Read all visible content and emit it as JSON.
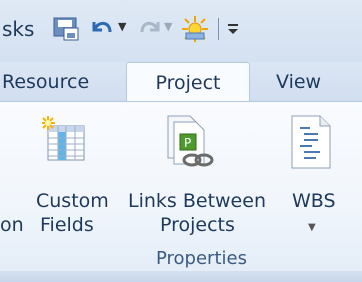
{
  "quick_access": {
    "partial_title": "sks",
    "icons": [
      "save-icon",
      "undo-icon",
      "redo-icon",
      "sun-icon",
      "customize-icon"
    ]
  },
  "tabs": [
    {
      "label": "Resource",
      "active": false
    },
    {
      "label": "Project",
      "active": true
    },
    {
      "label": "View",
      "active": false
    }
  ],
  "ribbon": {
    "buttons": {
      "partial_left": {
        "line1": "",
        "line2": "on"
      },
      "custom_fields": {
        "line1": "Custom",
        "line2": "Fields",
        "icon": "custom-fields-icon"
      },
      "links_between_projects": {
        "line1": "Links Between",
        "line2": "Projects",
        "icon": "links-icon"
      },
      "wbs": {
        "line1": "WBS",
        "icon": "wbs-icon",
        "dropdown": "▼"
      }
    },
    "group_label": "Properties"
  }
}
